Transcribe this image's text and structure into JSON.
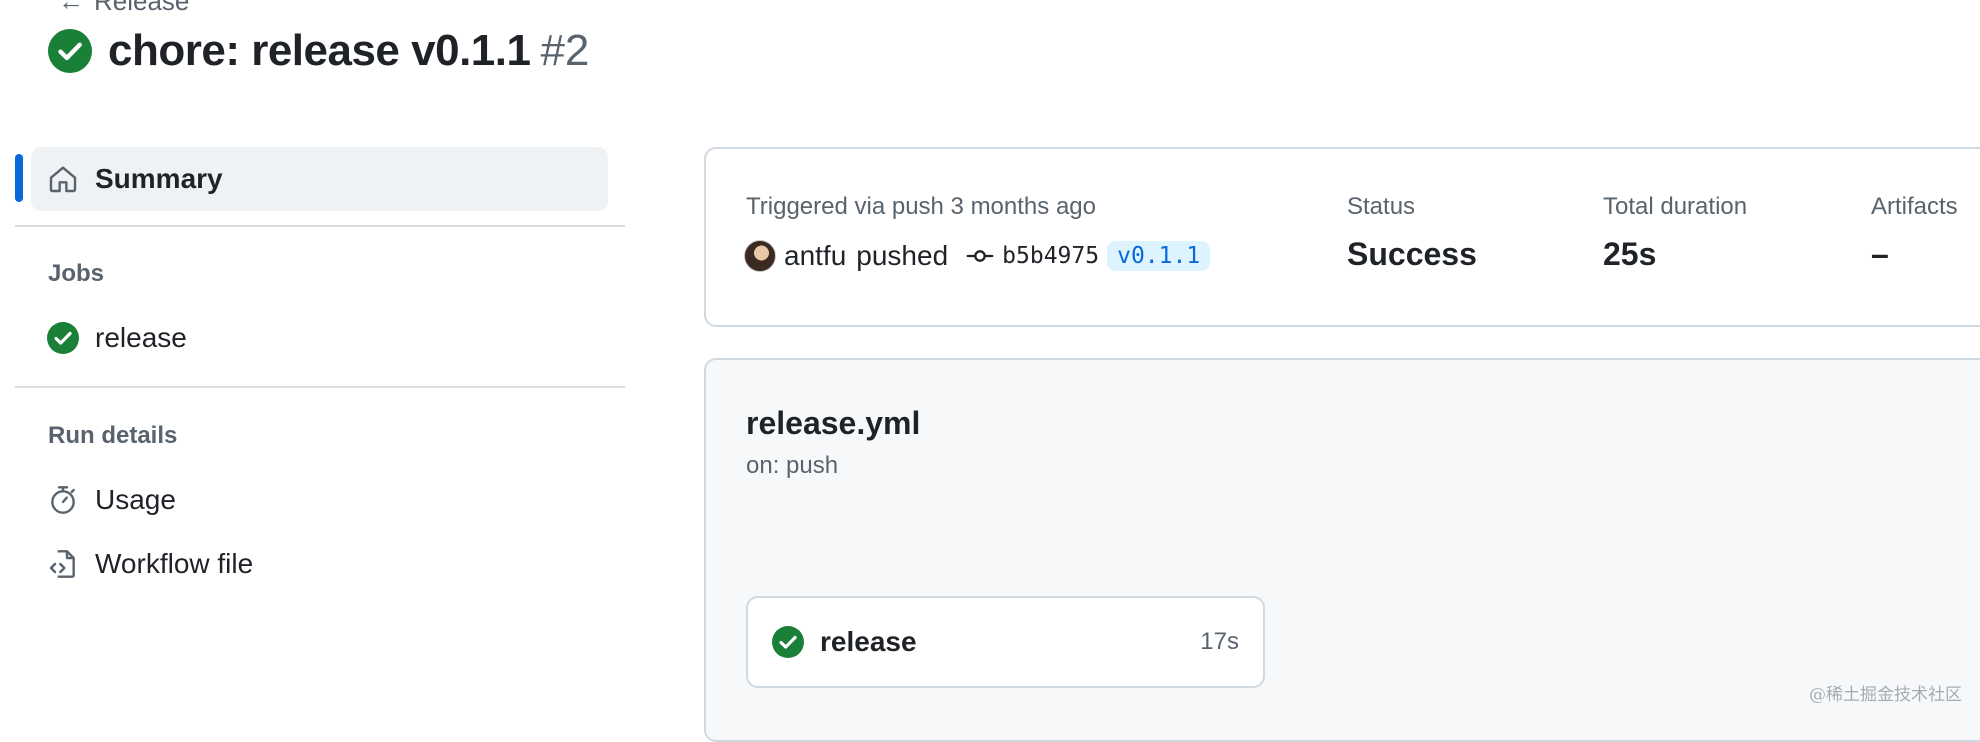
{
  "header": {
    "back_label": "Release",
    "title": "chore: release v0.1.1",
    "run_number": "#2"
  },
  "sidebar": {
    "summary_label": "Summary",
    "jobs_heading": "Jobs",
    "jobs": [
      {
        "label": "release",
        "status": "success"
      }
    ],
    "run_details_heading": "Run details",
    "run_details": [
      {
        "label": "Usage",
        "icon": "stopwatch-icon"
      },
      {
        "label": "Workflow file",
        "icon": "file-code-icon"
      }
    ]
  },
  "summary_card": {
    "trigger_text": "Triggered via push 3 months ago",
    "author": "antfu",
    "action": "pushed",
    "commit_sha": "b5b4975",
    "tag": "v0.1.1",
    "status_label": "Status",
    "status_value": "Success",
    "duration_label": "Total duration",
    "duration_value": "25s",
    "artifacts_label": "Artifacts",
    "artifacts_value": "–"
  },
  "workflow": {
    "file_name": "release.yml",
    "trigger": "on: push",
    "jobs": [
      {
        "name": "release",
        "duration": "17s",
        "status": "success"
      }
    ]
  },
  "watermark": "@稀土掘金技术社区",
  "colors": {
    "success": "#1a7f37",
    "accent": "#0969da",
    "tag_bg": "#ddf4ff",
    "muted_text": "#59636e",
    "border": "#d1d9e0"
  }
}
